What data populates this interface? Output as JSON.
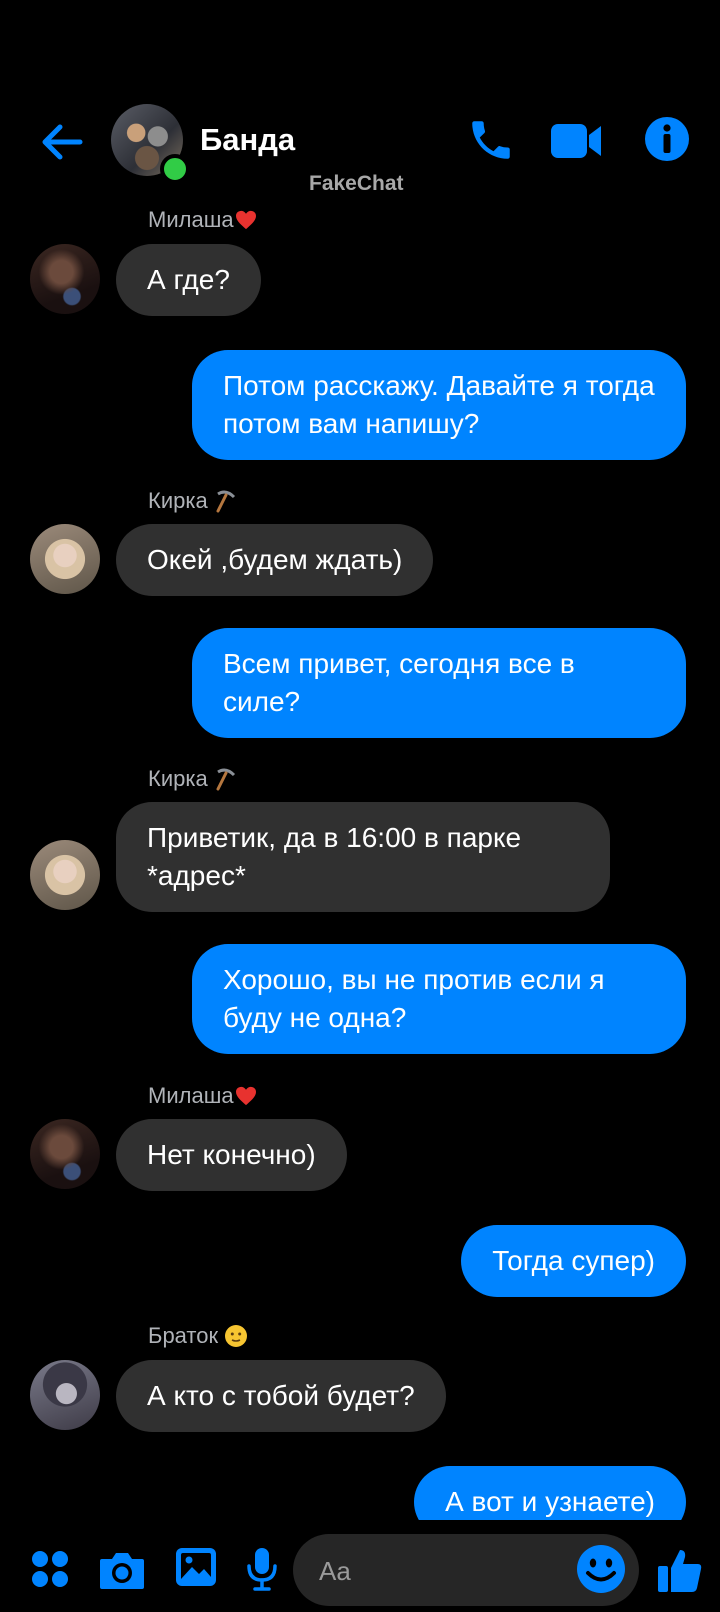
{
  "header": {
    "title": "Банда",
    "watermark": "FakeChat"
  },
  "messages": [
    {
      "type": "in",
      "sender": "Милаша",
      "text": "А где?"
    },
    {
      "type": "out",
      "text": "Потом расскажу. Давайте я тогда потом вам напишу?"
    },
    {
      "type": "in",
      "sender": "Кирка",
      "text": "Окей ,будем ждать)"
    },
    {
      "type": "out",
      "text": "Всем привет, сегодня все в силе?"
    },
    {
      "type": "in",
      "sender": "Кирка",
      "text": "Приветик, да в 16:00 в парке *адрес*"
    },
    {
      "type": "out",
      "text": "Хорошо, вы не против если я буду не одна?"
    },
    {
      "type": "in",
      "sender": "Милаша",
      "text": "Нет конечно)"
    },
    {
      "type": "out",
      "text": "Тогда супер)"
    },
    {
      "type": "in",
      "sender": "Браток",
      "text": "А кто с тобой будет?"
    },
    {
      "type": "out",
      "text": "А вот и узнаете)"
    }
  ],
  "composer": {
    "placeholder": "Aa"
  },
  "colors": {
    "accent": "#0084ff",
    "incoming_bubble": "#303030",
    "online": "#31cc46"
  },
  "icons": [
    "back-arrow-icon",
    "phone-icon",
    "video-camera-icon",
    "info-icon",
    "apps-icon",
    "camera-icon",
    "gallery-icon",
    "microphone-icon",
    "emoji-icon",
    "thumbs-up-icon"
  ]
}
